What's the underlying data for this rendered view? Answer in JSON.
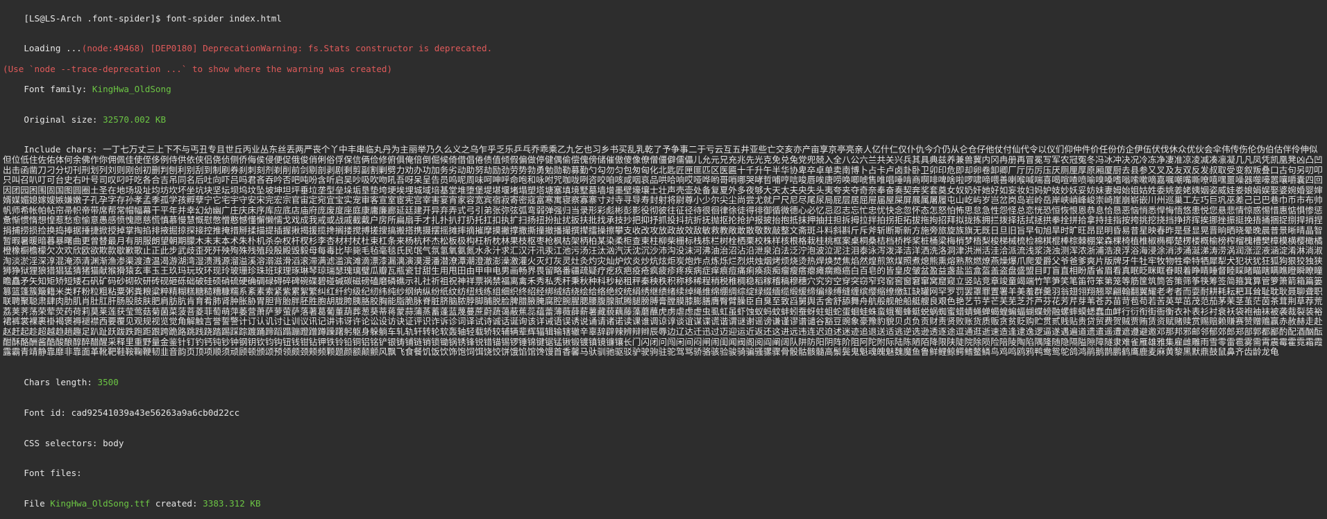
{
  "prompt": "[LS@LS-Arch .font-spider]$ font-spider index.html",
  "loading": {
    "prefix": "Loading ...",
    "warning": "(node:49468) [DEP0180] DeprecationWarning: fs.Stats constructor is deprecated.",
    "trace": "(Use `node --trace-deprecation ...` to show where the warning was created)"
  },
  "font_family": {
    "label": "Font family: ",
    "value": "KingHwa_OldSong"
  },
  "original_size": {
    "label": "Original size: ",
    "value": "32570.002 KB"
  },
  "include_chars": {
    "label": "Include chars: ",
    "value": "一丁七万丈三上下不与丐丑专且世丘丙业丛东丝丢两严丧个丫中丰串临丸丹为主丽举乃久么义之乌乍乎乏乐乒乓乔乖乘乙九乞也习乡书买乱乳乾了予争事二于亏云互五井亚些亡交亥亦产亩享京亭亮亲人亿什仁仅仆仇今介仍从仑仓仔他仗付仙代令以仪们仰仲件价任份仿企伊伍伏伐休众优伙会伞伟传伤伦伪伯估伴伶伸似但位低住佐佑体何余佛作你佣佩佳使侄侈例侍供依侠侣侥侦侧侨侮侯侵便促俄俊俏俐俗俘保信俩俭修俯俱俺倍倒倔候倚借倡倦债值倾假偏做停健偶偷偿傀傍储催傲傻像僚僧僵僻儒儡儿允元兄充兆先光克免兑兔党兜兢入全八公六兰共关兴兵其具典兹养兼兽冀内冈冉册再冒冕写军农冠冤冬冯冰冲决况冷冻净凄准凉凌减凑凛凝几凡凤凭凯凰凳凶凸凹出击函凿刀刁分切刊刑划列刘则刚创初删判刨利别刮到制刷券刹刺刻剂剃削前剑剔剖剥剧剩剪副割剿劈力劝办功加务劣动助努劫励劲劳势勃勇勉勋勒募勤勺勾勿匀包匆匈化北匙匠匣匪匹区医匾十千升午半华协卑卒卓单卖南博卜占卡卢卤卦卧卫卯印危即却卵卷卸卿厂厅历厉压厌厕厘厚原厢厦厨去县参又叉及友双反发叔取受变叙叛叠口古句另叨叩只叫召叭叮可台史右叶号司叹叼吁吃各合吉吊同名后吐向吓吕吗君吝吞吟否吧吨吩含听启吴吵吸吹吻吼吾呀呆呈告员呜呢周味呵呻呼命咆和咏咐咒咖咙咧咨咬咱咳咸咽哀品哄哈响哎哑哗哟哥哨哪哭哮哲哺哼唁唆唇唉唐唠唤唧唬售唯唱唾啃商啊啡啤啥啦啰啸啼喂善喇喉喊喘喜喝喧喳喷喻嗅嗓嗜嗡嗦嗽嘀嘉嘱嘲嘴嘶嘹嘻嘿噩噪器噬嚎嚣嚷嚼囊四回因团园困围固国图圆圈土圣在地场圾址均坊坎坏坐坑块坚坛坝坞坟坠坡坤坦坪垂垃垄型垒垛垢垦垫垮埂埃埋城域培基堂堆堕堡堤堪堰堵塌塑塔塘塞填境墅墓墙增墨壁壕壤士壮声壳壶处备复夏外多夜够大天太夫央失头夷夸夹夺奇奈奉奋奏契奔奖套奠女奴奶奸她好如妄妆妇妈妒妓妙妖妥妨妹妻姆始姐姑姓委姚姜姥姨姻姿威娃娄娘娟娱娶婆婉婚婴婶婿媒媚媳嫁嫂嫉嫌嫩子孔孕字存孙孝孟季孤学孩孵孽宁它宅宇守安宋完宏宗官宙定宛宜宝实宠审客宣室宦宪宫宰害宴宵家容宽宾宿寂寄密寇富寒寓寝察寡寨寸对寺寻导寿封射将尉尊小少尔尖尘尚尝尤就尸尺尼尽尾尿局屁层居屈屉届屋屎屏展属屠履屯山屹屿岁岂岔岗岛岩岭岳岸峡峭峰峻崇崎崖崩崭嵌川州巡巢工左巧巨巩巫差己已巴巷巾币市布帅帆师希帐帕帖帘帚帜帝带席帮常帽幅幕干平年并幸幻幼幽广庄庆床序库应底店庙府庞废度座庭康庸廉廊延廷建开异弃弄式弓引弟张弥弦弧弯弱弹强归当录形彩彪彬彭影役彻彼往征径待很徊律徐徒得徘御循微德心必忆忌忍志忘忙忠忧快念忽怀态怎怒怕怖思怠急性怨怪总恋恍恐恒恢恨恩恭息恰恳恶恼悄悉悍悔悟悠患悦您悬悲情惊惑惕惜惠惦惧惨惩惫惭惯惰想惶惹愁愈愉意愚感愤愧愿慈慌慎慕慢慧慨慰憋憎憨憾懂懈懒懦戈戏成我戒或战戚截戴户房所扁扇手才扎扑扒打扔托扛扣执扩扫扬扭扮扯扰扳扶批找承技抄把抑抒抓投抖抗折抚抛抠抡抢护报披抬抱抵抹押抽拄担拆拇拉拌拍拐拒拓拔拖拘招拜拟拢拣拥拦拨择括拭拯拱拳拴拼拾拿持挂指按挎挑挖挠挡挣挤挥挨挪挫振挺挽捂捅捆捉捌捍捎捏捐捕捞损捡换捣捧据捶捷掀授掉掌掏掐排掖掘掠探接控推掩措掰揉描提插握揪揭援揽搀搁搂搅搏搓搜搞搬搭携摄摆摇摊摔摘摧摩摸撇撑撒撕撞撤播撮撰撵擂操擦攀支收改攻放政故效敌敏救教敞敢散敬数敲整文斋斑斗料斜斟斤斥斧斩断斯新方施旁旅旋族旗无既日旦旧旨早旬旭旱时旷旺昂昆明昏易昔星映春昨是昼显晃晋晌晒晓晕晚晨普景晰晴晶智暂暇暑暖暗暮暴曙曲更曾替最月有朋服朗望朝期朦木未末本术朱朴机杀杂权杆杈杉李杏材村杖杜束杠条来杨杭杯杰松板极构枉析枕林果枝枢枣枪枫枯架柄柏某染柔柜查柬柱柳柴栅标栈栋栏树栓栖栗校株样核根格栽桂桃框案桌桐桑桔档桥桦桨桩桶梁梅梢梦梧梨梭梯械梳检棉棋棍棒棕棘棚棠森棵椅植椎椒椭椰楚楞楼概榆榜榨榴槐槽樊樟模横樱橄橘橙橡橱檐檬欠次欢欣欧欲欺款歇歉歌止正此步武歧歪死歼殃殉殊残殖段殷殿毁毅母每毒比毕毙毛毡毫毯氏民氓气氛氢氧氨氮水永汁求汇汉汗汛汞江池污汤汪汰汹汽沃沈沉沙沛沟没沫河沸油治沼沾沿泄泉泊法泛泞泡波泣泥注泪泰泳泻泼泽洁洋洒洗洛洞津洪洲活洼洽派流浅浆浇浊测浑浓浙浦浩浪浮浴海浸涂消涉涌涎涕涛涝涡润涨涩液涵淀淆淋淌淑淘淡淤淫深淳混淹添清渊渐渔渗渠渡渣温渴游湖湾湿溃溅源溜溢溪溶溺滋滑滔滚滞满滤滥滨滩滴漂漆漏漓演漠漫潘潜潦潭潮澄澈澎澡激灌火灭灯灰灵灶灸灼灾灿炉炊炎炒炕炫炬炭炮炸点炼烁烂烈烘烛烟烤烦烧烫热焊焕焚焦焰然煌煎煞煤照煮熄熊熏熔熟熬燃燎燕燥爆爪爬爱爵父爷爸爹爽片版牌牙牛牡牢牧物牲牵特牺犀犁犬犯状犹狂狐狗狠狡独狭狮狰狱狸狼猎猖猛猜猪猫献猴猾猿玄率玉王玖玛玩玫环现玲玻珊珍珠班球理琢琳琴琼瑞瑟瑰璃璧瓜瓣瓦瓶瓷甘甜生用甩田由甲申电男画畅界畏留略番疆疏疑疗疙疚疤疫疮疯疲疹疼疾病症痒痕痘痛痢痪痰痴瘤瘦瘩瘪瘫瘸瘾癌白百皂的皆皇皮皱盆盈益盏盐监盒盔盖盗盘盛盟目盯盲直相盼盾省眉看真眠眨眯眶眷眼着睁睛睡督睦睬睹瞄瞎瞒瞧瞪瞬瞭瞳瞻矗矛矢知矩矫短矮石矾矿码砂砌砍研砖砚砸砾础破硅硕硝硫硬确碉碌碍碎碑碗碟碧碰碱碳磁磅磕磨磷礁示礼社祈祖祝神祥票祸禁福离禽禾秀私秃秆秉秋种科秒秘租秤秦秧秩积称移稀程稍税稚稠稳稻稼稽稿穆穗穴究穷空穿突窃窄窍窑窖窗窘窜窝窟窥立竖站竞章竣童竭端竹竿笋笑笔笛符笨第笼等筋筐筑筒答策筛筝筷筹签简箍箕算管箩箫箭箱篇篓篡篮篷簇簸籍米类籽粉粒粗粘粟粥粪粮粱粹精糊糕糖糙糟糠糯系紊素索紧紫累絮繁纠红纤约级纪纫纬纯纱纲纳纵纷纸纹纺纽线练组细织终绍经绑绒结绕绘给络绝绞统绢绣继绩绪续绰绳维绵绷绸综绽绿缀缅缆缎缓缔编缘缚缝缠缤缨缩缭缴缸缺罐网罕罗罚罢罩罪置署羊美羞群羹羽翁翅翎翔翘翠翩翰翻翼耀老考者而耍耐耕耗耘耙耳耸耻耽耿聂聊聋职联聘聚聪肃肆肉肋肌肖肚肛肝肠股肢肤肥肩肪肮肯育肴肺肾肿胀胁胃胆背胎胖胚胜胞胡胧胯胰胳胶胸能脂脆脉脊脏脐脑脓脖脚脯脱脸脾腊腋腌腐腔腕腥腮腰腹腺腻腾腿膀膊膏膛膜膝膨膳膺臀臂臊臣自臭至致舀舅舆舌舍舒舔舞舟航般舰舱船艇艘良艰色艳艺节芋芒芙芜芝芥芦芬花芳芹芽苇苍苏苗苛苞苟若苦英苹茁茂范茄茅茉茎茧茫茵茶茸荆草荐荒荔荚荠荡荣荤荧药荷莉莫莱莲获莹莺菇菊菌菜菠菩菱菲萄萌萍萎营萧萨萝萤萨落著葛葡董葫葬葱葵蒂蒋蒙蒜蒲蒸蓄蓬蓝蔑蔓蔗蔚蔬蔼蔽蕉蕊蕴蕾薄薇薛薪薯藏藐藕藤藻蘑蘸虎虏虐虑虚虫虱虹虽虾蚀蚁蚂蚊蚌蚓蚕蚜蛀蛆蛇蛋蛔蛙蛛蛮蛾蜀蜂蜓蜕蜗蜘蜜蜡蜻蝇蝉蝎蝗蝙蝠蝴蝶螃融螺蟀蟆蟋蠢血衅行衍衔街衙衡衣补表衫衬衰袄袋袍袖袜被袭裁裂装裕裙裤裳裸裹褂褐褒褥褪襟西要覆见观规视览觉角解触言誉誓警计订认讥讨让训议讯记讲讳讶许论讼设访诀证评识诈诉诊词译试诗诚话诞询该详诫语误诱说诵请诸诺读课谁调谅谆谈谊谋谍谎谐谓谜谢谣谤谦谨谬谱谴谷豁豆豌象豪豫豹貌贝贞负贡财责贤败账货质贩贪贫贬购贮贯贰贱贴贵贷贸费贺贼贾贿赁资赋赌赎赏赐赔赖赚赛赞赠赡赢赤赦赫走赴赵赶起趁超越趋趟趣足趴趾跃跋跌跑距跟跨跪路跳践跷踏踢踩踪踱踊蹄蹈蹋蹦蹬蹭蹲躁躇躬躯身躲躺车轧轨轩转轮软轰轴轻载轿较辅辆辈辉辐辑输辖辙辛辜辞辟辣辨辩辫辰辱边辽达迁迅过迈迎运近返还这进远违连迟迫述迷迹追退送适逃逆选逊透逐途逗通逛逝速造逢逮逸逻逼遂遇遍道遗遣遥遭遮遵避邀邓那邦邪邮邻郁郊郎郑部郭都鄙酌配酒酗酝酣酥酪酬酱酷酸酿醇醉醋醒采释里重野量金鉴针钉钓钙钝钞钟钢钥钦钧钩钮钱钳钻钾铁铃铅铜铝铭铲银铸铺链销锁锄锅锈锋锐错锚锡锣锤锦键锯锰锹锻镀镇镜镰镶长门闪闭问闯闲间闷闸闹闺闻阀阁阅阎阐阔队阱防阳阴阵阶阻阿陀附际陆陈陋陌降限陕陡院除陨险陪陵陶陷隅隆随隐隔隘隙障隧隶难雀雁雄雅集雇雌雕雨雪零雷雹雾需霄震霉霍霓霜霞露霸青靖静靠靡非靠面革靴靶鞋鞍鞠鞭韧韭音韵页顶项顺须顽顾顿颁颂预领颇颈颊频颗题颜额颠颤风飘飞食餐饥饭饮饰饱饲饵饶饺饼饿馅馆馋馒首香馨马驮驯驰驱驳驴驶驹驻驼驾骂骄骆骇验骏骑骗骚骡骤骨骰骷骸髓高鬃鬓鬼魁魂魄魅魏魔鱼鲁鲜鲤鲸鳄鳍鳖鳞鸟鸡鸣鸥鸦鸭鸯鸳鸵鸽鸿鹃鹅鹊鹏鹤鹰鹿麦麻黄黎黑默鼎鼓鼠鼻齐齿龄龙龟"
  },
  "chars_length": {
    "label": "Chars length: ",
    "value": "3500"
  },
  "font_id": {
    "label": "Font id: ",
    "value": "cad92541039a43e56263a9a6cb0d22cc"
  },
  "css_selectors": {
    "label": "CSS selectors: ",
    "value": "body"
  },
  "font_files": {
    "label": "Font files:"
  },
  "file_created": {
    "prefix": "File ",
    "file": "KingHwa_OldSong.ttf",
    "mid": " created: ",
    "size": "3383.312 KB"
  }
}
